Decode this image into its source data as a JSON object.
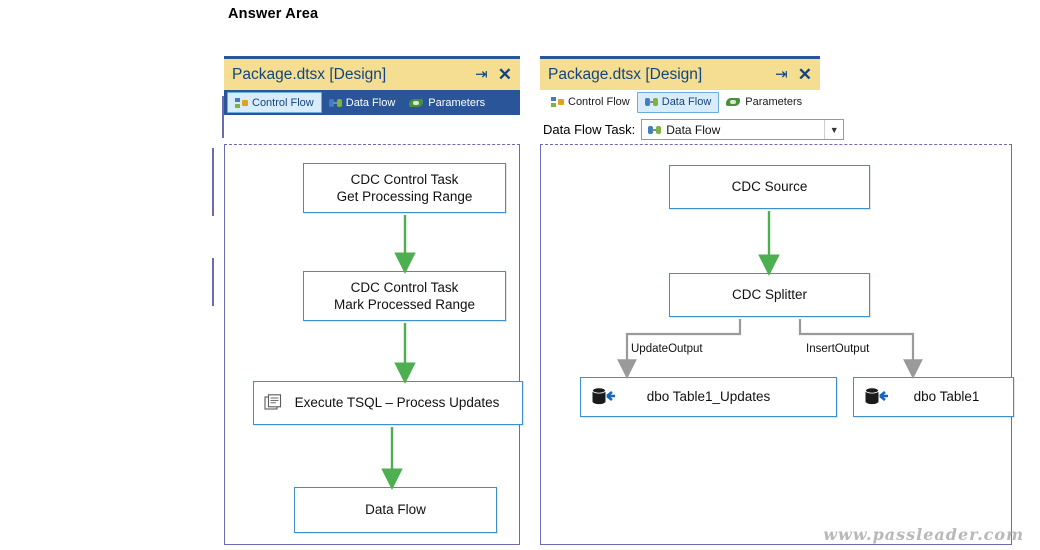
{
  "page": {
    "answer_area_title": "Answer Area",
    "watermark": "www.passleader.com"
  },
  "left_window": {
    "title": "Package.dtsx [Design]",
    "pin_icon": "pin-icon",
    "close_icon": "close-icon",
    "tabs": [
      {
        "label": "Control Flow",
        "icon": "control-flow-icon",
        "selected": true
      },
      {
        "label": "Data Flow",
        "icon": "data-flow-icon",
        "selected": false
      },
      {
        "label": "Parameters",
        "icon": "parameters-icon",
        "selected": false
      }
    ],
    "nodes": [
      {
        "id": "cdc-get-range",
        "line1": "CDC Control Task",
        "line2": "Get Processing Range"
      },
      {
        "id": "cdc-mark-range",
        "line1": "CDC Control Task",
        "line2": "Mark Processed Range"
      },
      {
        "id": "execute-tsql",
        "line1": "Execute TSQL – Process Updates",
        "line2": ""
      },
      {
        "id": "data-flow",
        "line1": "Data Flow",
        "line2": ""
      }
    ]
  },
  "right_window": {
    "title": "Package.dtsx [Design]",
    "pin_icon": "pin-icon",
    "close_icon": "close-icon",
    "tabs": [
      {
        "label": "Control Flow",
        "icon": "control-flow-icon",
        "selected": false
      },
      {
        "label": "Data Flow",
        "icon": "data-flow-icon",
        "selected": true
      },
      {
        "label": "Parameters",
        "icon": "parameters-icon",
        "selected": false
      }
    ],
    "data_flow_task": {
      "label": "Data Flow Task:",
      "selected_value": "Data Flow",
      "dropdown_icon": "chevron-down-icon",
      "item_icon": "data-flow-icon"
    },
    "nodes": [
      {
        "id": "cdc-source",
        "label": "CDC Source"
      },
      {
        "id": "cdc-splitter",
        "label": "CDC Splitter"
      },
      {
        "id": "dbo-table1-updates",
        "label": "dbo Table1_Updates"
      },
      {
        "id": "dbo-table1",
        "label": "dbo Table1"
      }
    ],
    "edge_labels": [
      {
        "id": "update-output",
        "text": "UpdateOutput"
      },
      {
        "id": "insert-output",
        "text": "InsertOutput"
      }
    ]
  },
  "colors": {
    "title_blue": "#12457c",
    "tabstrip_blue": "#2a5699",
    "node_border": "#3f8fce",
    "canvas_border": "#6a6ab5",
    "arrow_green": "#4caf50",
    "connector_gray": "#808080"
  }
}
